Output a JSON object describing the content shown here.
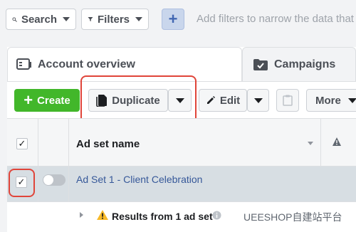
{
  "filterbar": {
    "search_label": "Search",
    "filters_label": "Filters",
    "add_label": "+",
    "hint": "Add filters to narrow the data that y"
  },
  "tabs": [
    {
      "label": "Account overview",
      "icon": "account-overview-icon",
      "active": true
    },
    {
      "label": "Campaigns",
      "icon": "folder-icon",
      "active": false
    }
  ],
  "toolbar": {
    "create_label": "Create",
    "duplicate_label": "Duplicate",
    "edit_label": "Edit",
    "more_label": "More"
  },
  "table": {
    "column_header": "Ad set name",
    "rows": [
      {
        "name": "Ad Set 1 - Client Celebration",
        "checked": true,
        "active": false
      }
    ],
    "results_label": "Results from 1 ad set"
  },
  "watermark": "UEESHOP自建站平台",
  "colors": {
    "create_green": "#42b72a",
    "link_blue": "#365899",
    "highlight_red": "#e0453a",
    "selected_row": "#d7dee3"
  }
}
